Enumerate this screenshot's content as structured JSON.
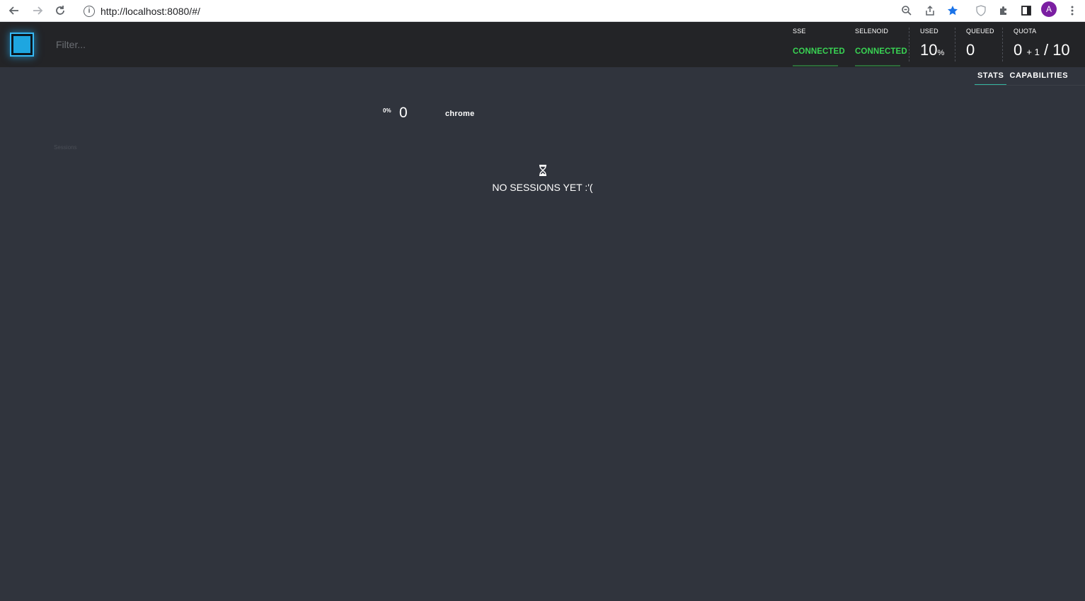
{
  "browser": {
    "url": "http://localhost:8080/#/",
    "avatar_letter": "A"
  },
  "header": {
    "filter_placeholder": "Filter...",
    "sse": {
      "title": "SSE",
      "status": "CONNECTED"
    },
    "selenoid": {
      "title": "SELENOID",
      "status": "CONNECTED"
    },
    "used": {
      "title": "USED",
      "value": "10",
      "unit": "%"
    },
    "queued": {
      "title": "QUEUED",
      "value": "0"
    },
    "quota": {
      "title": "QUOTA",
      "used": "0",
      "pending": "+ 1",
      "separator": "/",
      "total": "10"
    },
    "status_color": "#39d353"
  },
  "tabs": [
    {
      "label": "STATS",
      "active": true
    },
    {
      "label": "CAPABILITIES",
      "active": false
    }
  ],
  "stats": {
    "percent": "0%",
    "count": "0",
    "browser_name": "chrome"
  },
  "sessions": {
    "label": "Sessions",
    "empty_message": "NO SESSIONS YET :'("
  }
}
